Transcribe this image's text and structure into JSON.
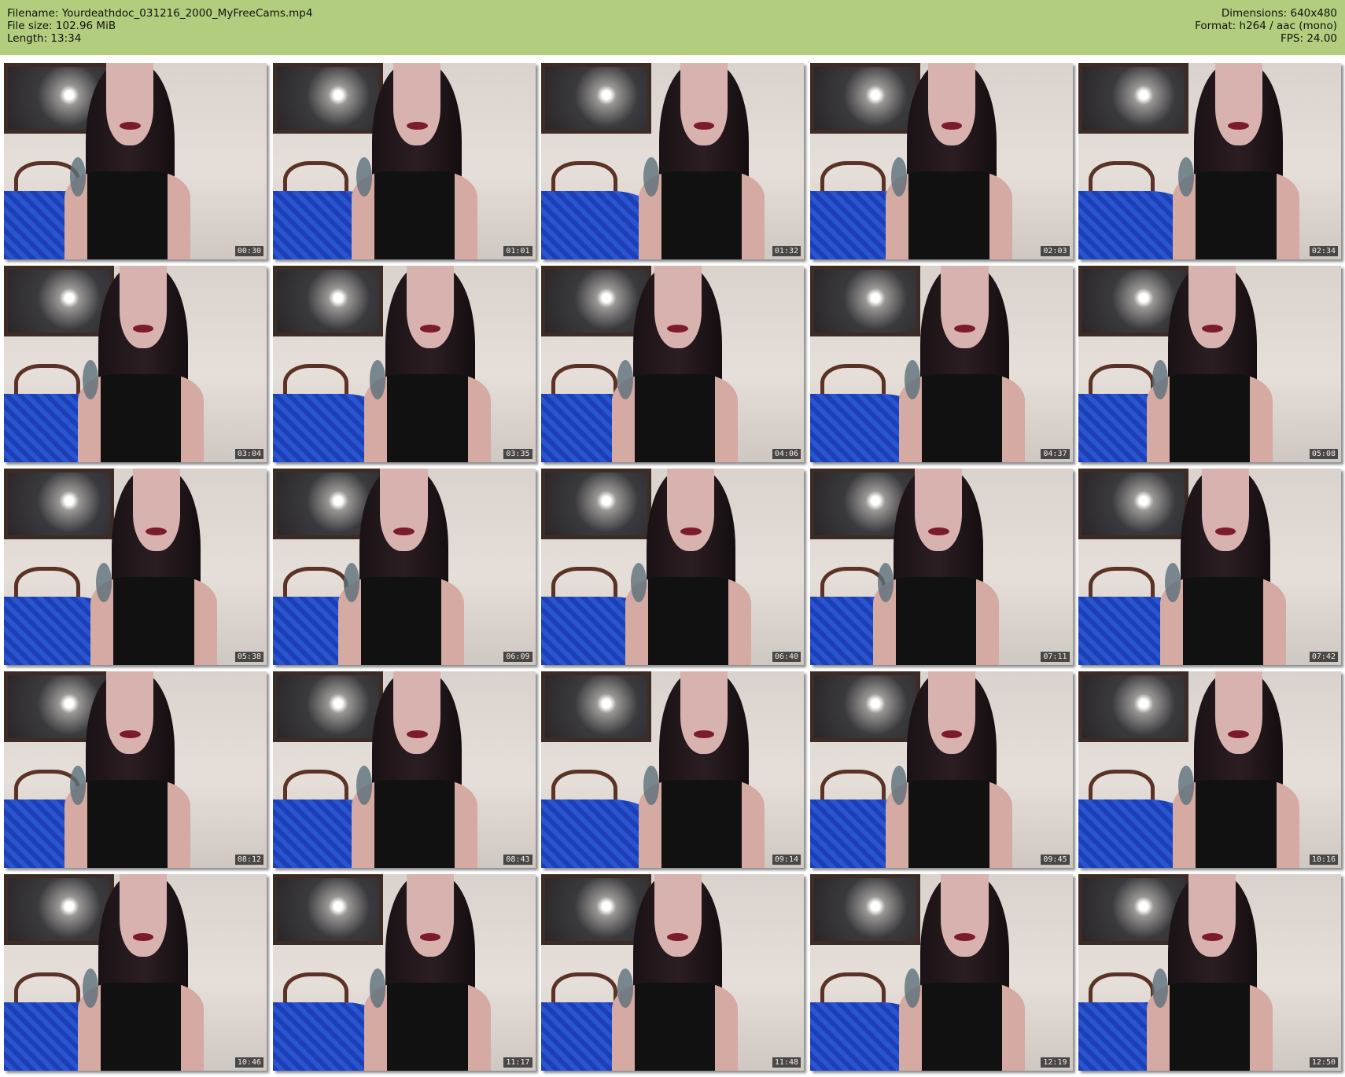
{
  "header": {
    "filename": "Filename: Yourdeathdoc_031216_2000_MyFreeCams.mp4",
    "filesize": "File size: 102.96 MiB",
    "length": "Length: 13:34",
    "dimensions": "Dimensions: 640x480",
    "format": "Format: h264 / aac (mono)",
    "fps": "FPS: 24.00",
    "background_color": "#b1cd7d"
  },
  "thumbnails": [
    {
      "time": "00:30"
    },
    {
      "time": "01:01"
    },
    {
      "time": "01:32"
    },
    {
      "time": "02:03"
    },
    {
      "time": "02:34"
    },
    {
      "time": "03:04"
    },
    {
      "time": "03:35"
    },
    {
      "time": "04:06"
    },
    {
      "time": "04:37"
    },
    {
      "time": "05:08"
    },
    {
      "time": "05:38"
    },
    {
      "time": "06:09"
    },
    {
      "time": "06:40"
    },
    {
      "time": "07:11"
    },
    {
      "time": "07:42"
    },
    {
      "time": "08:12"
    },
    {
      "time": "08:43"
    },
    {
      "time": "09:14"
    },
    {
      "time": "09:45"
    },
    {
      "time": "10:16"
    },
    {
      "time": "10:46"
    },
    {
      "time": "11:17"
    },
    {
      "time": "11:48"
    },
    {
      "time": "12:19"
    },
    {
      "time": "12:50"
    }
  ]
}
